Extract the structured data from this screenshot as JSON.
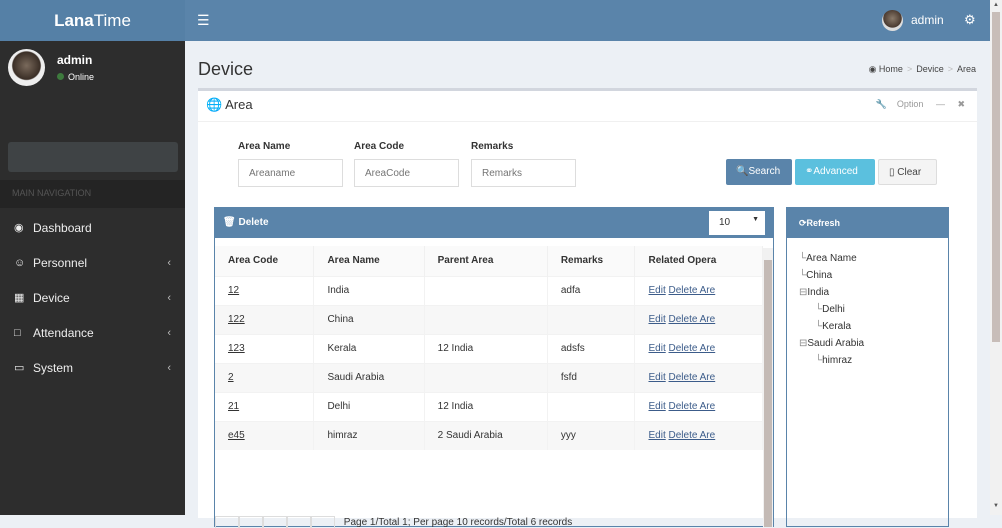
{
  "app": {
    "logo_bold": "Lana",
    "logo_rest": "Time",
    "user": "admin"
  },
  "sidebar": {
    "user": "admin",
    "status": "Online",
    "nav_header": "MAIN NAVIGATION",
    "items": [
      {
        "label": "Dashboard",
        "icon": "dashboard-icon"
      },
      {
        "label": "Personnel",
        "icon": "users-icon"
      },
      {
        "label": "Device",
        "icon": "device-icon"
      },
      {
        "label": "Attendance",
        "icon": "attendance-icon"
      },
      {
        "label": "System",
        "icon": "laptop-icon"
      }
    ]
  },
  "page": {
    "title": "Device",
    "breadcrumb": [
      "Home",
      "Device",
      "Area"
    ]
  },
  "box": {
    "title": "Area",
    "option": "Option"
  },
  "filters": {
    "area_name_label": "Area Name",
    "area_name_ph": "Areaname",
    "area_code_label": "Area Code",
    "area_code_ph": "AreaCode",
    "remarks_label": "Remarks",
    "remarks_ph": "Remarks"
  },
  "buttons": {
    "search": "Search",
    "advanced": "Advanced",
    "clear": "Clear",
    "delete": "Delete",
    "refresh": "Refresh"
  },
  "table": {
    "page_size": "10",
    "headers": [
      "Area Code",
      "Area Name",
      "Parent Area",
      "Remarks",
      "Related Opera"
    ],
    "rows": [
      {
        "code": "12",
        "name": "India",
        "parent": "",
        "remarks": "adfa"
      },
      {
        "code": "122",
        "name": "China",
        "parent": "",
        "remarks": ""
      },
      {
        "code": "123",
        "name": "Kerala",
        "parent": "12 India",
        "remarks": "adsfs"
      },
      {
        "code": "2",
        "name": "Saudi Arabia",
        "parent": "",
        "remarks": "fsfd"
      },
      {
        "code": "21",
        "name": "Delhi",
        "parent": "12 India",
        "remarks": ""
      },
      {
        "code": "e45",
        "name": "himraz",
        "parent": "2 Saudi Arabia",
        "remarks": "yyy"
      }
    ],
    "edit": "Edit",
    "delete_area": "Delete Are",
    "pager_text": "Page 1/Total 1; Per page 10 records/Total 6 records"
  },
  "tree": [
    {
      "label": "Area Name",
      "level": 0
    },
    {
      "label": "China",
      "level": 0
    },
    {
      "label": "India",
      "level": 0
    },
    {
      "label": "Delhi",
      "level": 1
    },
    {
      "label": "Kerala",
      "level": 1
    },
    {
      "label": "Saudi Arabia",
      "level": 0
    },
    {
      "label": "himraz",
      "level": 1
    }
  ]
}
